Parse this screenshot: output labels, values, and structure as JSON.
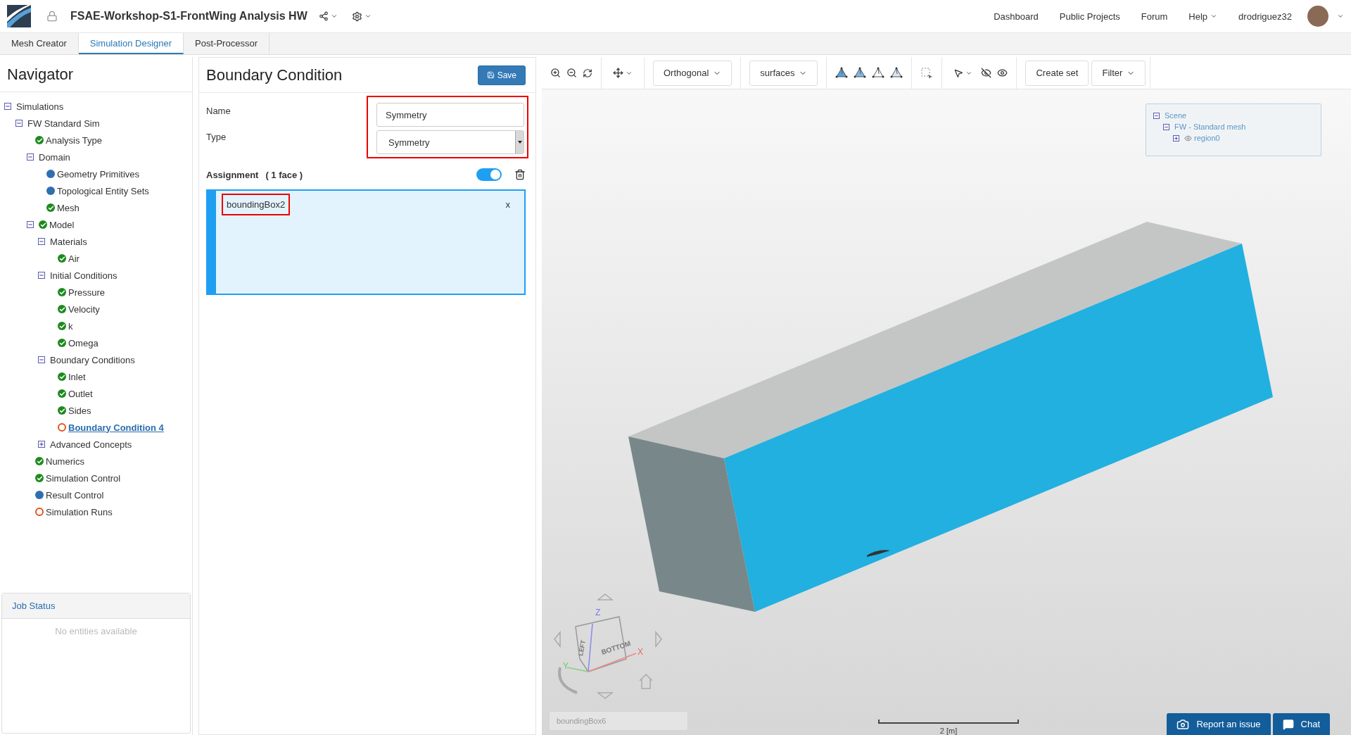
{
  "header": {
    "project_title": "FSAE-Workshop-S1-FrontWing Analysis HW",
    "nav_links": [
      "Dashboard",
      "Public Projects",
      "Forum",
      "Help"
    ],
    "username": "drodriguez32"
  },
  "tabs": [
    {
      "label": "Mesh Creator",
      "selected": false
    },
    {
      "label": "Simulation Designer",
      "selected": true
    },
    {
      "label": "Post-Processor",
      "selected": false
    }
  ],
  "navigator": {
    "title": "Navigator",
    "tree": [
      {
        "label": "Simulations",
        "expanded": true,
        "selected": false,
        "children": [
          {
            "label": "FW Standard Sim",
            "expanded": true,
            "selected": false,
            "children": [
              {
                "label": "Analysis Type",
                "kind": "done",
                "selected": false
              },
              {
                "label": "Domain",
                "expanded": true,
                "selected": false,
                "children": [
                  {
                    "label": "Geometry Primitives",
                    "kind": "optional",
                    "selected": false
                  },
                  {
                    "label": "Topological Entity Sets",
                    "kind": "optional",
                    "selected": false
                  },
                  {
                    "label": "Mesh",
                    "kind": "done",
                    "selected": false
                  }
                ]
              },
              {
                "label": "Model",
                "expanded": true,
                "kind": "done",
                "selected": false,
                "children": [
                  {
                    "label": "Materials",
                    "expanded": true,
                    "selected": false,
                    "children": [
                      {
                        "label": "Air",
                        "kind": "done",
                        "selected": false
                      }
                    ]
                  },
                  {
                    "label": "Initial Conditions",
                    "expanded": true,
                    "selected": false,
                    "children": [
                      {
                        "label": "Pressure",
                        "kind": "done",
                        "selected": false
                      },
                      {
                        "label": "Velocity",
                        "kind": "done",
                        "selected": false
                      },
                      {
                        "label": "k",
                        "kind": "done",
                        "selected": false
                      },
                      {
                        "label": "Omega",
                        "kind": "done",
                        "selected": false
                      }
                    ]
                  },
                  {
                    "label": "Boundary Conditions",
                    "expanded": true,
                    "selected": false,
                    "children": [
                      {
                        "label": "Inlet",
                        "kind": "done",
                        "selected": false
                      },
                      {
                        "label": "Outlet",
                        "kind": "done",
                        "selected": false
                      },
                      {
                        "label": "Sides",
                        "kind": "done",
                        "selected": false
                      },
                      {
                        "label": "Boundary Condition 4",
                        "kind": "incomplete",
                        "selected": true
                      }
                    ]
                  },
                  {
                    "label": "Advanced Concepts",
                    "expanded": false,
                    "selected": false
                  }
                ]
              },
              {
                "label": "Numerics",
                "kind": "done",
                "selected": false
              },
              {
                "label": "Simulation Control",
                "kind": "done",
                "selected": false
              },
              {
                "label": "Result Control",
                "kind": "optional",
                "selected": false
              },
              {
                "label": "Simulation Runs",
                "kind": "incomplete",
                "selected": false
              }
            ]
          }
        ]
      }
    ]
  },
  "job_status": {
    "title": "Job Status",
    "empty_text": "No entities available"
  },
  "boundary_condition": {
    "title": "Boundary Condition",
    "save_label": "Save",
    "name_label": "Name",
    "name_value": "Symmetry",
    "type_label": "Type",
    "type_value": "Symmetry",
    "assignment_label": "Assignment",
    "assignment_count": "( 1 face )",
    "assignment_on": true,
    "assigned_items": [
      {
        "label": "boundingBox2",
        "remove": "x",
        "highlighted": true
      }
    ],
    "fields_highlighted": true
  },
  "viewer": {
    "toolbar": {
      "projection": "Orthogonal",
      "render_mode": "surfaces",
      "create_set": "Create set",
      "filter": "Filter"
    },
    "scene_tree": [
      {
        "label": "Scene",
        "expanded": true,
        "children": [
          {
            "label": "FW - Standard mesh",
            "expanded": true,
            "children": [
              {
                "label": "region0",
                "expanded": false,
                "visible": true
              }
            ]
          }
        ]
      }
    ],
    "view_cube": {
      "faces": [
        "LEFT",
        "BOTTOM"
      ],
      "axes": [
        "X",
        "Y",
        "Z"
      ]
    },
    "selection_label": "boundingBox6",
    "scale_label": "2 [m]"
  },
  "support": {
    "report": "Report an issue",
    "chat": "Chat"
  }
}
